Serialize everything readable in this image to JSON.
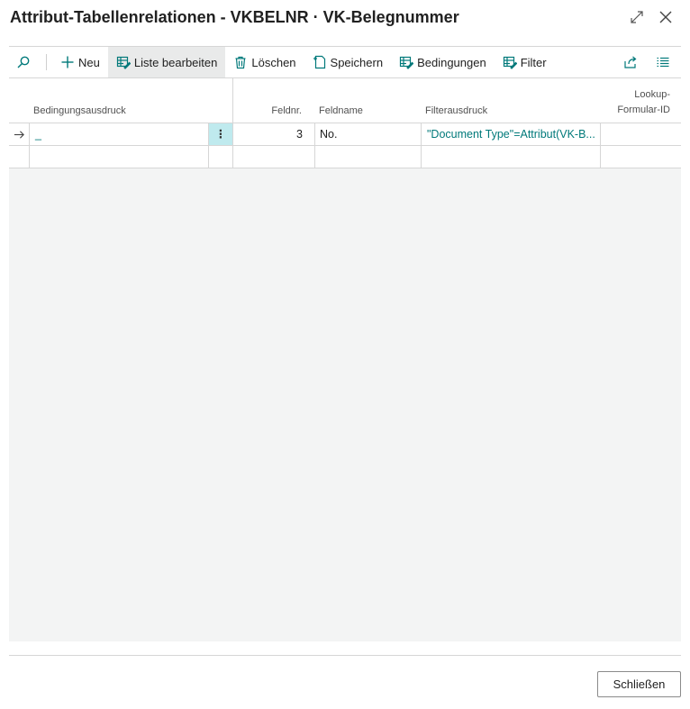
{
  "dialog": {
    "title": "Attribut-Tabellenrelationen - VKBELNR · VK-Belegnummer"
  },
  "toolbar": {
    "new_label": "Neu",
    "edit_list_label": "Liste bearbeiten",
    "delete_label": "Löschen",
    "save_label": "Speichern",
    "conditions_label": "Bedingungen",
    "filter_label": "Filter"
  },
  "table": {
    "columns": {
      "condition": "Bedingungsausdruck",
      "field_no": "Feldnr.",
      "field_name": "Feldname",
      "filter": "Filterausdruck",
      "lookup_line1": "Lookup-",
      "lookup_line2": "Formular-ID"
    },
    "rows": [
      {
        "condition": "_",
        "field_no": "3",
        "field_name": "No.",
        "filter": "\"Document Type\"=Attribut(VK-B...",
        "lookup": ""
      }
    ]
  },
  "footer": {
    "close_label": "Schließen"
  },
  "colors": {
    "accent": "#00797a",
    "selected_cell": "#bfeaee"
  }
}
